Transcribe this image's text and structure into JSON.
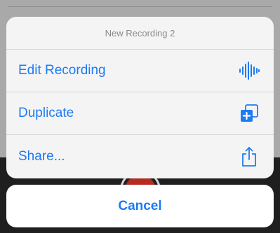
{
  "sheet": {
    "title": "New Recording 2",
    "items": [
      {
        "label": "Edit Recording",
        "icon": "waveform-icon"
      },
      {
        "label": "Duplicate",
        "icon": "duplicate-icon"
      },
      {
        "label": "Share...",
        "icon": "share-icon"
      }
    ]
  },
  "cancel": {
    "label": "Cancel"
  },
  "colors": {
    "accent": "#1d7bf5",
    "header_text": "#8a8a8e",
    "sheet_bg": "#f4f4f5",
    "cancel_bg": "#ffffff",
    "record_red": "#b52b22"
  }
}
